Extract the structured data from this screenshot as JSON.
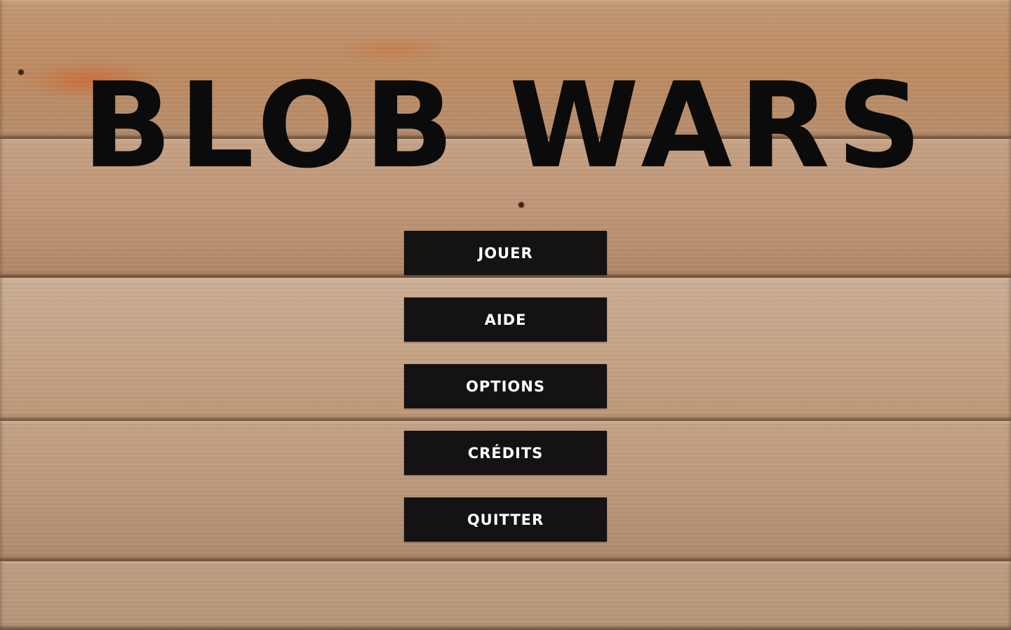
{
  "game": {
    "title": "BLOB WARS"
  },
  "menu": {
    "items": [
      {
        "label": "JOUER"
      },
      {
        "label": "AIDE"
      },
      {
        "label": "OPTIONS"
      },
      {
        "label": "CRÉDITS"
      },
      {
        "label": "QUITTER"
      }
    ]
  },
  "colors": {
    "button_background": "#141212",
    "button_text": "#ffffff",
    "title_text": "#0b0b0b",
    "wood_base": "#c49a78"
  }
}
